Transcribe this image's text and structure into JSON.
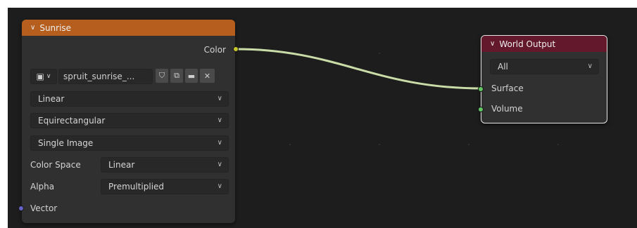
{
  "sunrise_node": {
    "title": "Sunrise",
    "output_color_label": "Color",
    "image_name": "spruit_sunrise_...",
    "interpolation": "Linear",
    "projection": "Equirectangular",
    "source": "Single Image",
    "color_space_label": "Color Space",
    "color_space_value": "Linear",
    "alpha_label": "Alpha",
    "alpha_value": "Premultiplied",
    "input_vector_label": "Vector"
  },
  "world_output_node": {
    "title": "World Output",
    "target": "All",
    "surface_label": "Surface",
    "volume_label": "Volume"
  },
  "colors": {
    "sunrise_header": "#b65e1d",
    "world_output_header": "#63182c",
    "color_socket": "#c7c729",
    "shader_socket": "#63c763",
    "vector_socket": "#6363c7",
    "link": "#d4e8b0"
  },
  "icons": {
    "image_type": "image-icon",
    "fake_user": "shield-icon",
    "duplicate": "duplicate-icon",
    "open": "folder-icon",
    "unlink": "close-icon"
  }
}
